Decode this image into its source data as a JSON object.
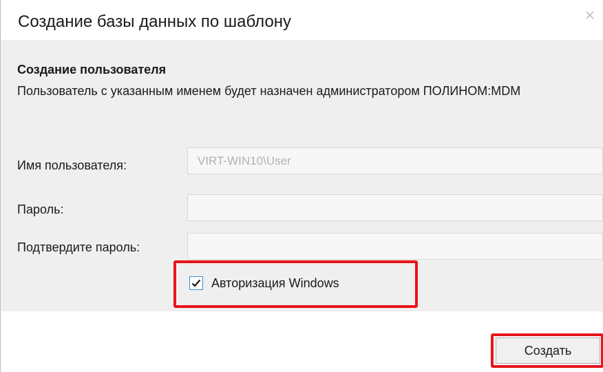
{
  "dialog": {
    "title": "Создание базы данных по шаблону",
    "close_icon": "close-icon"
  },
  "section": {
    "title": "Создание пользователя",
    "description": "Пользователь с указанным именем будет назначен администратором ПОЛИНОМ:MDM"
  },
  "form": {
    "username": {
      "label": "Имя пользователя:",
      "value": "VIRT-WIN10\\User",
      "disabled": true
    },
    "password": {
      "label": "Пароль:",
      "value": ""
    },
    "confirm_password": {
      "label": "Подтвердите пароль:",
      "value": ""
    },
    "windows_auth": {
      "label": "Авторизация Windows",
      "checked": true,
      "icon": "checkmark-icon"
    }
  },
  "footer": {
    "create_label": "Создать"
  },
  "colors": {
    "content_background": "#efefef",
    "highlight": "#e8141c",
    "checkbox_border": "#3a8fd6",
    "input_disabled_text": "#b2b2b2"
  }
}
